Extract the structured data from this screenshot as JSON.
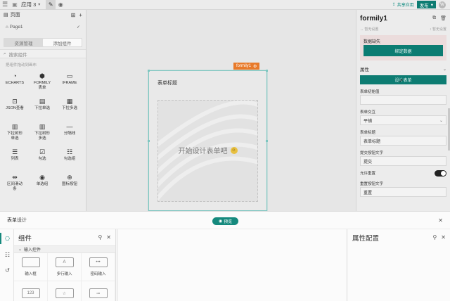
{
  "topbar": {
    "app_name": "应用 3",
    "share_label": "共享应用",
    "publish_label": "发布",
    "avatar_letter": "W"
  },
  "left": {
    "pages_title": "页面",
    "page1": "Page1",
    "tabs": [
      "资源管理",
      "添加组件"
    ],
    "search_placeholder": "搜索组件",
    "drag_tip": "把组件拖动到画布",
    "components": [
      {
        "label": "ECHARTS",
        "icon": "echarts-icon"
      },
      {
        "label": "FORMILY\n表单",
        "icon": "formily-icon"
      },
      {
        "label": "IFRAME",
        "icon": "iframe-icon"
      },
      {
        "label": "JSON查看",
        "icon": "json-viewer-icon"
      },
      {
        "label": "下拉单选",
        "icon": "select-single-icon"
      },
      {
        "label": "下拉多选",
        "icon": "select-multi-icon"
      },
      {
        "label": "下拉树形\n单选",
        "icon": "tree-single-icon"
      },
      {
        "label": "下拉树形\n多选",
        "icon": "tree-multi-icon"
      },
      {
        "label": "分隔线",
        "icon": "divider-icon"
      },
      {
        "label": "列表",
        "icon": "list-icon"
      },
      {
        "label": "勾选",
        "icon": "checkbox-icon"
      },
      {
        "label": "勾选组",
        "icon": "checkbox-group-icon"
      },
      {
        "label": "区间滑动\n条",
        "icon": "range-slider-icon"
      },
      {
        "label": "单选组",
        "icon": "radio-group-icon"
      },
      {
        "label": "图标按钮",
        "icon": "icon-button-icon"
      }
    ]
  },
  "canvas": {
    "tag_label": "formily1",
    "form_title": "表单标题",
    "design_hint": "开始设计表单吧"
  },
  "right": {
    "title": "formily1",
    "sub_left": "暂无设置",
    "sub_right": "暂无设置",
    "datasource_label": "数据缺失",
    "datasource_button": "绑定数据",
    "section_props": "属性",
    "design_button": "设计表单",
    "fields": [
      {
        "label": "表单初始值",
        "value": ""
      },
      {
        "label": "表单交互",
        "value": "平铺",
        "dropdown": true
      },
      {
        "label": "表单标题",
        "value": "表单标题"
      },
      {
        "label": "提交按钮文字",
        "value": "提交"
      }
    ],
    "allow_reset_label": "允许重置",
    "allow_reset_on": true,
    "reset_button_label": "重置按钮文字",
    "reset_button_value": "重置"
  },
  "bottom": {
    "title": "表单设计",
    "preview_label": "预览",
    "components_title": "组件",
    "group_label": "输入控件",
    "props_title": "属性配置",
    "components": [
      {
        "label": "输入框",
        "glyph": ""
      },
      {
        "label": "多行输入",
        "glyph": "A"
      },
      {
        "label": "密码输入",
        "glyph": "•••"
      },
      {
        "label": "",
        "glyph": "123"
      },
      {
        "label": "",
        "glyph": "☆"
      },
      {
        "label": "",
        "glyph": "⊸"
      }
    ]
  }
}
